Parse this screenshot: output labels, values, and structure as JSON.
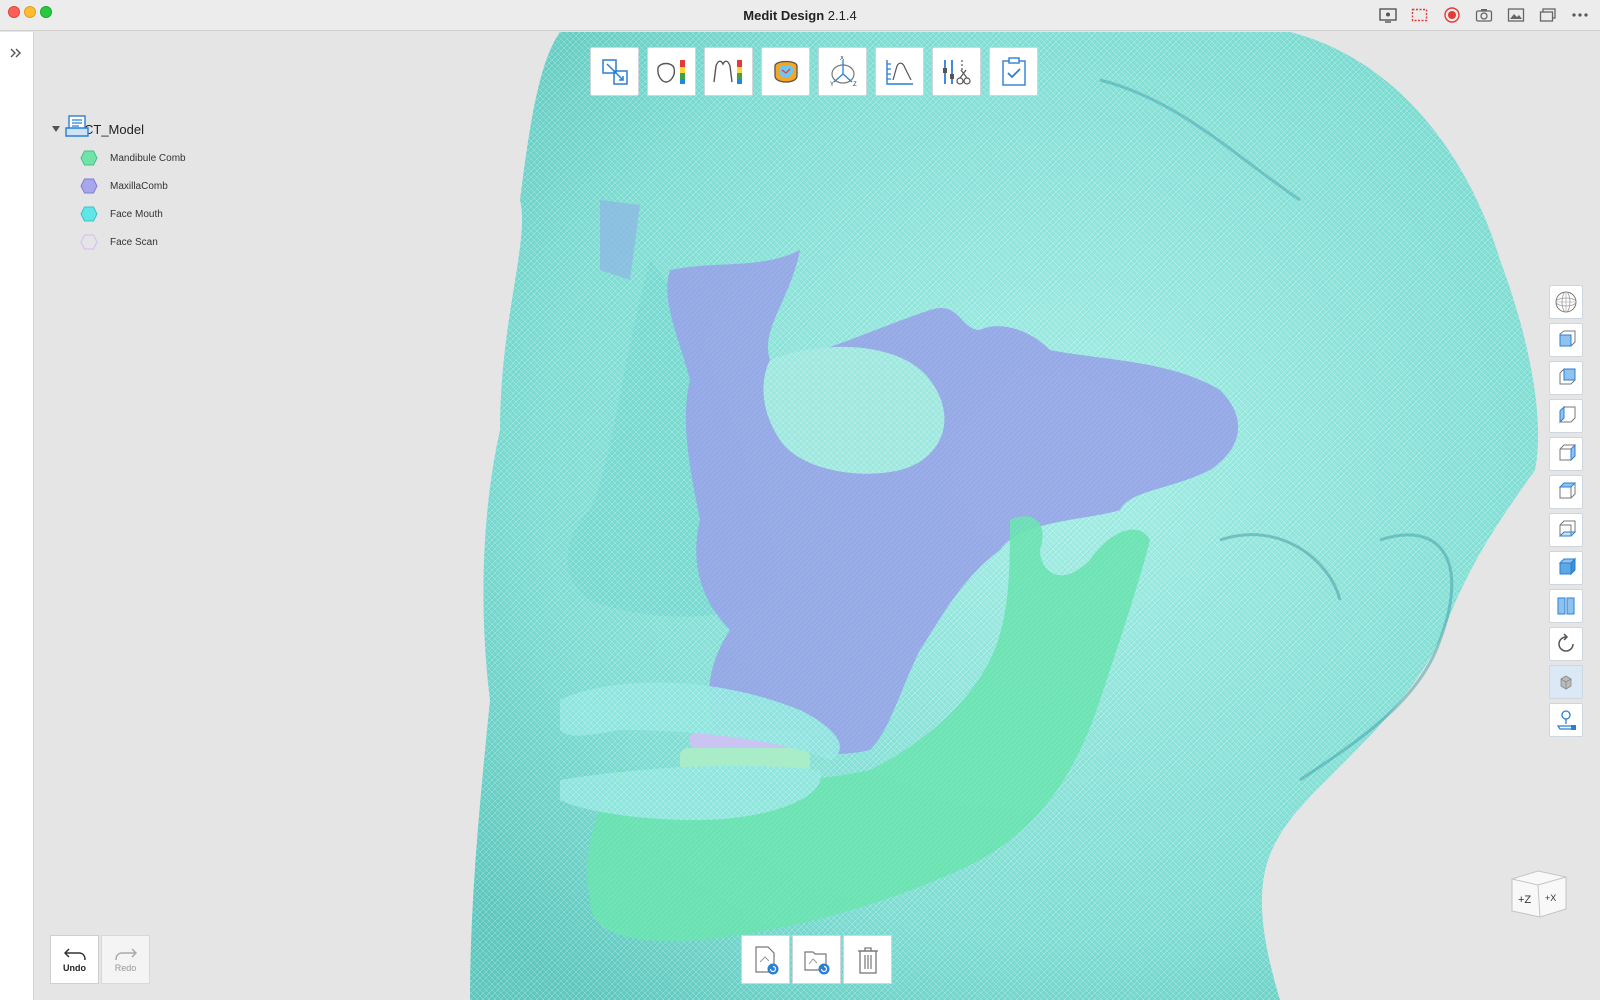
{
  "window": {
    "title_name": "Medit Design",
    "title_version": "2.1.4"
  },
  "titlebar_icons": [
    "screen-mirror-icon",
    "screen-capture-icon",
    "record-icon",
    "camera-icon",
    "image-icon",
    "windows-icon",
    "more-icon"
  ],
  "model_tree": {
    "root_label": "CT_Model",
    "items": [
      {
        "label": "Mandibule Comb",
        "color": "#6fe3a8"
      },
      {
        "label": "MaxillaComb",
        "color": "#a7a6ee"
      },
      {
        "label": "Face Mouth",
        "color": "#5fe6e6"
      },
      {
        "label": "Face Scan",
        "color": "#d9c6f0"
      }
    ]
  },
  "top_toolbar": [
    "align-icon",
    "deviation-map-icon",
    "cross-section-icon",
    "occlusion-icon",
    "axis-rotate-icon",
    "measure-icon",
    "trim-tools-icon",
    "complete-icon"
  ],
  "right_toolbar": [
    "mesh-sphere-icon",
    "view-front-icon",
    "view-back-icon",
    "view-left-icon",
    "view-right-icon",
    "view-top-icon",
    "view-bottom-icon",
    "view-iso-icon",
    "split-view-icon",
    "rotate-icon",
    "texture-toggle-icon",
    "camera-pin-icon"
  ],
  "bottom_left": {
    "undo_label": "Undo",
    "redo_label": "Redo"
  },
  "bottom_toolbar": [
    "import-file-icon",
    "open-folder-icon",
    "delete-icon"
  ],
  "orientation_cube": {
    "face1": "+Z",
    "face2": "+X"
  },
  "colors": {
    "face_scan": "#7fe0d6",
    "maxilla": "#9aa6e8",
    "mandible": "#6ee6b0",
    "accent_blue": "#2a7fd4"
  }
}
